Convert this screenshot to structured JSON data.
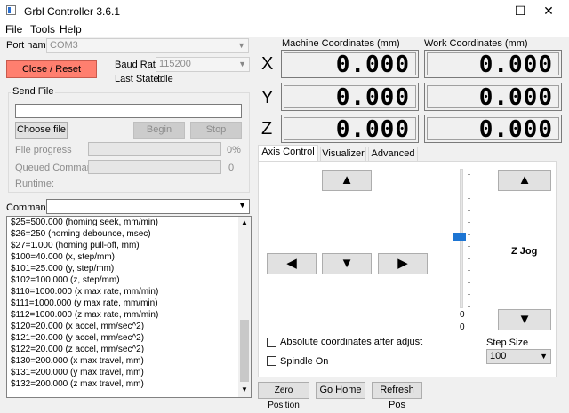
{
  "window": {
    "title": "Grbl Controller 3.6.1",
    "minimize": "—",
    "maximize": "☐",
    "close": "✕"
  },
  "menu": [
    "File",
    "Tools",
    "Help"
  ],
  "connection": {
    "port_label": "Port name",
    "port_value": "COM3",
    "close_reset_label": "Close / Reset",
    "baud_label": "Baud Rate",
    "baud_value": "115200",
    "last_state_label": "Last State:",
    "last_state_value": "Idle"
  },
  "send_file": {
    "group_label": "Send File",
    "file_path": "",
    "choose_label": "Choose file",
    "begin_label": "Begin",
    "stop_label": "Stop",
    "progress_label": "File progress",
    "progress_value": "0%",
    "progress_fraction": 0,
    "queued_label": "Queued Commands",
    "queued_value": "0",
    "runtime_label": "Runtime:"
  },
  "command": {
    "label": "Command",
    "value": ""
  },
  "log_lines": [
    "$25=500.000 (homing seek, mm/min)",
    "$26=250 (homing debounce, msec)",
    "$27=1.000 (homing pull-off, mm)",
    "$100=40.000 (x, step/mm)",
    "$101=25.000 (y, step/mm)",
    "$102=100.000 (z, step/mm)",
    "$110=1000.000 (x max rate, mm/min)",
    "$111=1000.000 (y max rate, mm/min)",
    "$112=1000.000 (z max rate, mm/min)",
    "$120=20.000 (x accel, mm/sec^2)",
    "$121=20.000 (y accel, mm/sec^2)",
    "$122=20.000 (z accel, mm/sec^2)",
    "$130=200.000 (x max travel, mm)",
    "$131=200.000 (y max travel, mm)",
    "$132=200.000 (z max travel, mm)"
  ],
  "coords": {
    "machine_label": "Machine Coordinates  (mm)",
    "work_label": "Work Coordinates   (mm)",
    "axes": [
      {
        "name": "X",
        "machine": "0.000",
        "work": "0.000"
      },
      {
        "name": "Y",
        "machine": "0.000",
        "work": "0.000"
      },
      {
        "name": "Z",
        "machine": "0.000",
        "work": "0.000"
      }
    ]
  },
  "tabs": [
    "Axis Control",
    "Visualizer",
    "Advanced"
  ],
  "axis_control": {
    "up": "▲",
    "down": "▼",
    "left": "◀",
    "right": "▶",
    "z_up": "▲",
    "z_down": "▼",
    "z_jog_label": "Z Jog",
    "slider_top_value": "0",
    "slider_bottom_value": "0",
    "absolute_label": "Absolute coordinates after adjust",
    "spindle_label": "Spindle On",
    "step_size_label": "Step Size",
    "step_size_value": "100"
  },
  "bottom_buttons": {
    "zero": "Zero Position",
    "home": "Go Home",
    "refresh": "Refresh Pos"
  }
}
